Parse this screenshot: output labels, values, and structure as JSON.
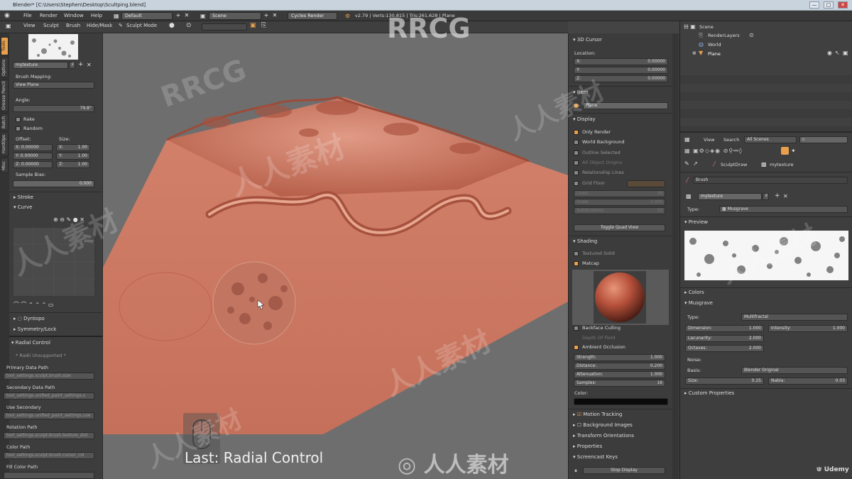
{
  "window": {
    "title": "Blender* [C:\\Users\\Stephen\\Desktop\\Scultping.blend]",
    "minimize": "—",
    "maximize": "□",
    "close": "✕"
  },
  "menubar": {
    "items": [
      "File",
      "Render",
      "Window",
      "Help"
    ],
    "layout": "Default",
    "scene": "Scene",
    "engine": "Cycles Render",
    "stats": "v2.79 | Verts:130,815 | Tris:261,628 | Plane"
  },
  "view_header": {
    "items": [
      "View",
      "Sculpt",
      "Brush",
      "Hide/Mask"
    ],
    "mode": "Sculpt Mode"
  },
  "left_tabs": [
    "Tools",
    "Options",
    "Grease Pencil",
    "Batch",
    "HardOps",
    "Misc"
  ],
  "left": {
    "texture_name": "mytexture",
    "brush_mapping_label": "Brush Mapping:",
    "brush_mapping_value": "View Plane",
    "angle_label": "Angle:",
    "angle_value": "79.8°",
    "rake": "Rake",
    "random": "Random",
    "offset_label": "Offset:",
    "size_label": "Size:",
    "offset": [
      "X: 0.00000",
      "Y: 0.00000",
      "Z: 0.00000"
    ],
    "size": [
      "X:",
      "Y:",
      "Z:"
    ],
    "size_values": [
      "1.00",
      "1.00",
      "1.00"
    ],
    "sample_bias_label": "Sample Bias:",
    "sample_bias_value": "0.000",
    "stroke": "Stroke",
    "curve": "Curve",
    "dyntopo": "Dyntopo",
    "symmetry": "Symmetry/Lock",
    "radial_control": "Radial Control",
    "radii_unsupported": "* Radii Unsupported *",
    "paths": [
      {
        "label": "Primary Data Path",
        "value": "tool_settings.sculpt.brush.size"
      },
      {
        "label": "Secondary Data Path",
        "value": "tool_settings.unified_paint_settings.s"
      },
      {
        "label": "Use Secondary",
        "value": "tool_settings.unified_paint_settings.use"
      },
      {
        "label": "Rotation Path",
        "value": "tool_settings.sculpt.brush.texture_slot"
      },
      {
        "label": "Color Path",
        "value": "tool_settings.sculpt.brush.cursor_col"
      },
      {
        "label": "Fill Color Path",
        "value": ""
      }
    ]
  },
  "viewport": {
    "last_operator": "Last: Radial Control"
  },
  "props": {
    "cursor_title": "3D Cursor",
    "location_label": "Location:",
    "cursor": [
      {
        "axis": "X:",
        "value": "0.00000"
      },
      {
        "axis": "Y:",
        "value": "0.00000"
      },
      {
        "axis": "Z:",
        "value": "0.00000"
      }
    ],
    "item_title": "Item",
    "item_name": "Plane",
    "display_title": "Display",
    "display_checks": [
      {
        "label": "Only Render",
        "on": true
      },
      {
        "label": "World Background",
        "on": false
      },
      {
        "label": "Outline Selected",
        "on": false
      },
      {
        "label": "All Object Origins",
        "on": false
      },
      {
        "label": "Relationship Lines",
        "on": false
      },
      {
        "label": "Grid Floor",
        "on": false
      }
    ],
    "grid_rows": [
      {
        "label": "Lines:",
        "value": "16"
      },
      {
        "label": "Scale:",
        "value": "1.000"
      },
      {
        "label": "Subdivisions:",
        "value": "10"
      }
    ],
    "toggle_quad": "Toggle Quad View",
    "shading_title": "Shading",
    "textured_solid": "Textured Solid",
    "matcap": "Matcap",
    "backface": "Backface Culling",
    "depth_of_field": "Depth Of Field",
    "ambient": "Ambient Occlusion",
    "ao_rows": [
      {
        "label": "Strength:",
        "value": "1.000"
      },
      {
        "label": "Distance:",
        "value": "0.200"
      },
      {
        "label": "Attenuation:",
        "value": "1.000"
      },
      {
        "label": "Samples:",
        "value": "16"
      }
    ],
    "color_label": "Color:",
    "panels": [
      "Motion Tracking",
      "Background Images",
      "Transform Orientations",
      "Properties",
      "Screencast Keys"
    ],
    "stop_display": "Stop Display"
  },
  "outliner": {
    "items": [
      "Scene",
      "RenderLayers",
      "World",
      "Plane"
    ]
  },
  "right": {
    "header_items": [
      "View",
      "Search"
    ],
    "scenes_select": "All Scenes",
    "brush_name": "SculptDraw",
    "texture_name": "mytexture",
    "brush_label": "Brush",
    "type_label": "Type:",
    "type_value": "Musgrave",
    "preview_title": "Preview",
    "colors_title": "Colors",
    "musgrave_title": "Musgrave",
    "musgrave_type_label": "Type:",
    "musgrave_type_value": "Multifractal",
    "dimension_label": "Dimension:",
    "dimension_value": "1.000",
    "intensity_label": "Intensity:",
    "intensity_value": "1.000",
    "lacunarity_label": "Lacunarity:",
    "lacunarity_value": "2.000",
    "octaves_label": "Octaves:",
    "octaves_value": "2.000",
    "noise_label": "Noise:",
    "basis_label": "Basis:",
    "basis_value": "Blender Original",
    "size_label": "Size:",
    "size_value": "0.25",
    "nabla_label": "Nabla:",
    "nabla_value": "0.03",
    "custom_props": "Custom Properties",
    "udemy": "Udemy"
  },
  "watermarks": [
    "RRCG",
    "人人素材",
    "人人素材"
  ],
  "colors": {
    "sculpt": "#d37a64",
    "accent": "#e8a04c"
  }
}
